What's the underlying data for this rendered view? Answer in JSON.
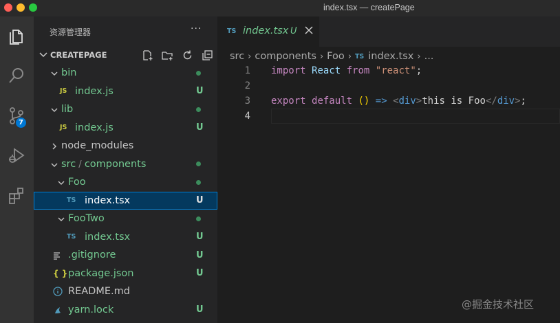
{
  "window": {
    "title": "index.tsx — createPage"
  },
  "activity": {
    "scm_badge": "7"
  },
  "sidebar": {
    "header": "资源管理器",
    "more": "···",
    "section_title": "CREATEPAGE",
    "tree": [
      {
        "label": "bin",
        "kind": "folder",
        "open": true,
        "depth": 1,
        "status": "dot"
      },
      {
        "label": "index.js",
        "kind": "js",
        "icon": "JS",
        "depth": 2,
        "status": "U"
      },
      {
        "label": "lib",
        "kind": "folder",
        "open": true,
        "depth": 1,
        "status": "dot"
      },
      {
        "label": "index.js",
        "kind": "js",
        "icon": "JS",
        "depth": 2,
        "status": "U"
      },
      {
        "label": "node_modules",
        "kind": "folder",
        "open": false,
        "depth": 1,
        "status": ""
      },
      {
        "label": "src / components",
        "kind": "folder",
        "open": true,
        "depth": 1,
        "status": "dot"
      },
      {
        "label": "Foo",
        "kind": "folder",
        "open": true,
        "depth": 2,
        "status": "dot"
      },
      {
        "label": "index.tsx",
        "kind": "ts",
        "icon": "TS",
        "depth": 3,
        "status": "U",
        "selected": true
      },
      {
        "label": "FooTwo",
        "kind": "folder",
        "open": true,
        "depth": 2,
        "status": "dot"
      },
      {
        "label": "index.tsx",
        "kind": "ts",
        "icon": "TS",
        "depth": 3,
        "status": "U"
      },
      {
        "label": ".gitignore",
        "kind": "lines",
        "depth": 1,
        "status": "U"
      },
      {
        "label": "package.json",
        "kind": "json",
        "icon": "{ }",
        "depth": 1,
        "status": "U"
      },
      {
        "label": "README.md",
        "kind": "info",
        "depth": 1,
        "status": ""
      },
      {
        "label": "yarn.lock",
        "kind": "yarn",
        "depth": 1,
        "status": "U"
      }
    ]
  },
  "editor": {
    "tab": {
      "icon": "TS",
      "name": "index.tsx",
      "status": "U"
    },
    "breadcrumb": [
      "src",
      "components",
      "Foo",
      "index.tsx",
      "..."
    ],
    "breadcrumb_icon": "TS",
    "lines": [
      {
        "num": "1",
        "tokens": [
          [
            "kw",
            "import"
          ],
          [
            "txt",
            " "
          ],
          [
            "id",
            "React"
          ],
          [
            "txt",
            " "
          ],
          [
            "kw",
            "from"
          ],
          [
            "txt",
            " "
          ],
          [
            "str",
            "\"react\""
          ],
          [
            "txt",
            ";"
          ]
        ]
      },
      {
        "num": "2",
        "tokens": []
      },
      {
        "num": "3",
        "tokens": [
          [
            "kw",
            "export"
          ],
          [
            "txt",
            " "
          ],
          [
            "kw",
            "default"
          ],
          [
            "txt",
            " "
          ],
          [
            "par",
            "()"
          ],
          [
            "txt",
            " "
          ],
          [
            "kwb",
            "=>"
          ],
          [
            "txt",
            " "
          ],
          [
            "tag",
            "<"
          ],
          [
            "tagn",
            "div"
          ],
          [
            "tag",
            ">"
          ],
          [
            "txt",
            "this is Foo"
          ],
          [
            "tag",
            "</"
          ],
          [
            "tagn",
            "div"
          ],
          [
            "tag",
            ">"
          ],
          [
            "txt",
            ";"
          ]
        ]
      },
      {
        "num": "4",
        "tokens": [],
        "current": true
      }
    ]
  },
  "watermark": "@掘金技术社区",
  "colors": {
    "accent": "#007fd4",
    "untracked": "#73c991",
    "selection": "#04395e"
  }
}
